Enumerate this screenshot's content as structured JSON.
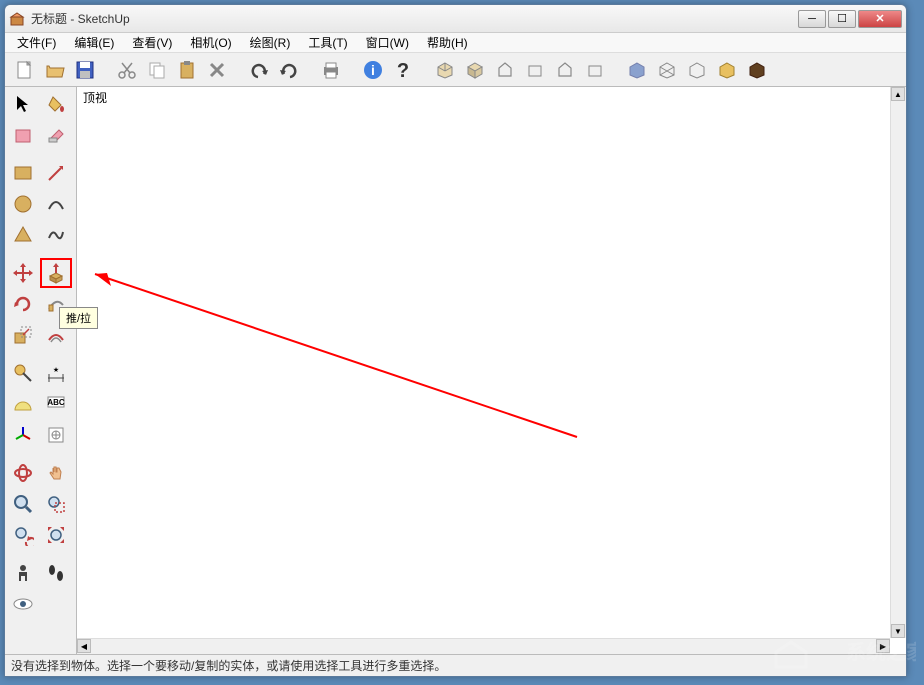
{
  "window": {
    "title": "无标题 - SketchUp"
  },
  "menu": {
    "file": "文件(F)",
    "edit": "编辑(E)",
    "view": "查看(V)",
    "camera": "相机(O)",
    "draw": "绘图(R)",
    "tools": "工具(T)",
    "window": "窗口(W)",
    "help": "帮助(H)"
  },
  "canvas": {
    "view_label": "顶视"
  },
  "tooltip": {
    "push_pull": "推/拉"
  },
  "statusbar": {
    "text": "没有选择到物体。选择一个要移动/复制的实体，或请使用选择工具进行多重选择。"
  },
  "watermark": {
    "text": "系统之家"
  },
  "icons": {
    "new": "新建",
    "open": "打开",
    "save": "保存",
    "cut": "剪切",
    "copy": "复制",
    "paste": "粘贴",
    "delete": "删除",
    "undo": "撤销",
    "redo": "重做",
    "print": "打印",
    "info": "信息",
    "help": "帮助"
  }
}
